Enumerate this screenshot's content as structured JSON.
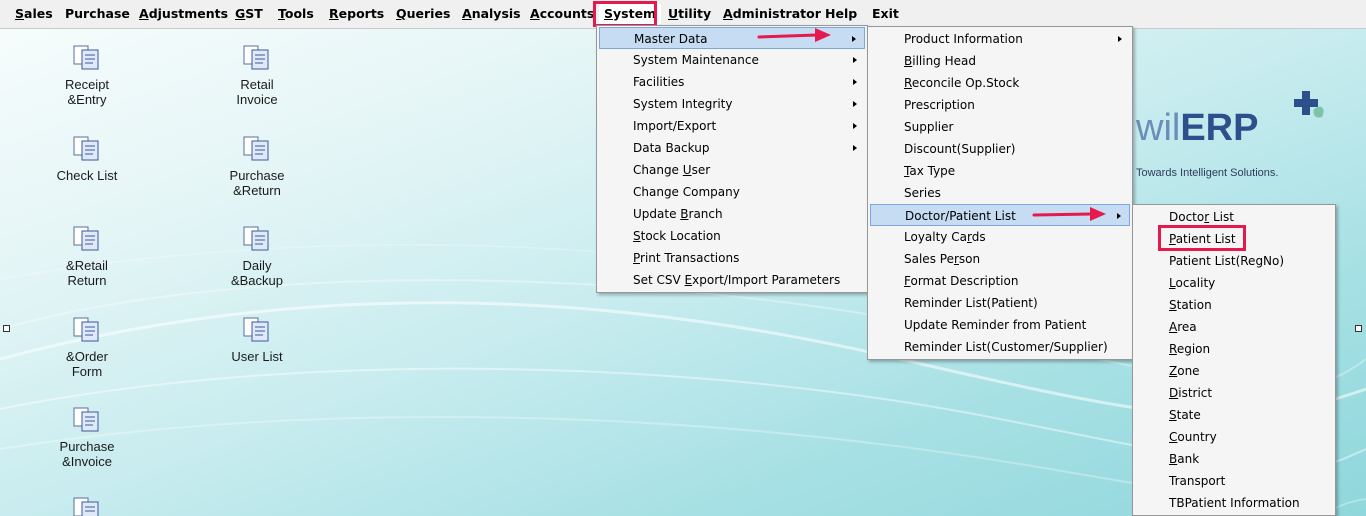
{
  "menubar": {
    "items": [
      {
        "key": "S",
        "rest": "ales"
      },
      {
        "key": "",
        "rest": "Purchase"
      },
      {
        "key": "A",
        "rest": "djustments"
      },
      {
        "key": "G",
        "rest": "ST"
      },
      {
        "key": "T",
        "rest": "ools"
      },
      {
        "key": "R",
        "rest": "eports"
      },
      {
        "key": "Q",
        "rest": "ueries"
      },
      {
        "key": "A",
        "rest": "nalysis"
      },
      {
        "key": "A",
        "rest": "ccounts"
      },
      {
        "key": "S",
        "rest": "ystem"
      },
      {
        "key": "U",
        "rest": "tility"
      },
      {
        "key": "A",
        "rest": "dministrator"
      },
      {
        "key": "",
        "rest": "Help"
      },
      {
        "key": "",
        "rest": "Exit"
      }
    ]
  },
  "desktop_icons": [
    {
      "label": "Receipt\n&Entry"
    },
    {
      "label": "Retail\nInvoice"
    },
    {
      "label": "Check List"
    },
    {
      "label": "Purchase\n&Return"
    },
    {
      "label": "&Retail\nReturn"
    },
    {
      "label": "Daily\n&Backup"
    },
    {
      "label": "&Order\nForm"
    },
    {
      "label": "User List"
    },
    {
      "label": "Purchase\n&Invoice"
    },
    {
      "label": ""
    }
  ],
  "logo": {
    "prefix": "wil",
    "brand": "ERP",
    "tagline": "Towards Intelligent Solutions."
  },
  "system_menu": {
    "items": [
      {
        "pre": "",
        "key": "",
        "post": "Master Data",
        "submenu": true
      },
      {
        "pre": "",
        "key": "",
        "post": "System Maintenance",
        "submenu": true
      },
      {
        "pre": "",
        "key": "",
        "post": "Facilities",
        "submenu": true
      },
      {
        "pre": "",
        "key": "",
        "post": "System Integrity",
        "submenu": true
      },
      {
        "pre": "",
        "key": "",
        "post": "Import/Export",
        "submenu": true
      },
      {
        "pre": "",
        "key": "",
        "post": "Data Backup",
        "submenu": true
      },
      {
        "pre": "Change ",
        "key": "U",
        "post": "ser",
        "submenu": false
      },
      {
        "pre": "Change Company",
        "key": "",
        "post": "",
        "submenu": false
      },
      {
        "pre": "Update ",
        "key": "B",
        "post": "ranch",
        "submenu": false
      },
      {
        "pre": "",
        "key": "S",
        "post": "tock Location",
        "submenu": false
      },
      {
        "pre": "",
        "key": "P",
        "post": "rint Transactions",
        "submenu": false
      },
      {
        "pre": "Set CSV ",
        "key": "E",
        "post": "xport/Import Parameters",
        "submenu": false
      }
    ]
  },
  "master_data_menu": {
    "items": [
      {
        "pre": "Product Information",
        "key": "",
        "post": "",
        "submenu": true
      },
      {
        "pre": "",
        "key": "B",
        "post": "illing Head",
        "submenu": false
      },
      {
        "pre": "",
        "key": "R",
        "post": "econcile Op.Stock",
        "submenu": false
      },
      {
        "pre": "Prescription",
        "key": "",
        "post": "",
        "submenu": false
      },
      {
        "pre": "Supplier",
        "key": "",
        "post": "",
        "submenu": false
      },
      {
        "pre": "Discount(Supplier)",
        "key": "",
        "post": "",
        "submenu": false
      },
      {
        "pre": "",
        "key": "T",
        "post": "ax Type",
        "submenu": false
      },
      {
        "pre": "Series",
        "key": "",
        "post": "",
        "submenu": false
      },
      {
        "pre": "Doctor/Patient List",
        "key": "",
        "post": "",
        "submenu": true
      },
      {
        "pre": "Loyalty Ca",
        "key": "r",
        "post": "ds",
        "submenu": false
      },
      {
        "pre": "Sales Pe",
        "key": "r",
        "post": "son",
        "submenu": false
      },
      {
        "pre": "",
        "key": "F",
        "post": "ormat Description",
        "submenu": false
      },
      {
        "pre": "Reminder List(Patient)",
        "key": "",
        "post": "",
        "submenu": false
      },
      {
        "pre": "Update Reminder from Patient",
        "key": "",
        "post": "",
        "submenu": false
      },
      {
        "pre": "Reminder List(Customer/Supplier)",
        "key": "",
        "post": "",
        "submenu": false
      }
    ]
  },
  "doctor_patient_menu": {
    "items": [
      {
        "pre": "Docto",
        "key": "r",
        "post": " List"
      },
      {
        "pre": "",
        "key": "P",
        "post": "atient List"
      },
      {
        "pre": "Patient List(RegNo)",
        "key": "",
        "post": ""
      },
      {
        "pre": "",
        "key": "L",
        "post": "ocality"
      },
      {
        "pre": "",
        "key": "S",
        "post": "tation"
      },
      {
        "pre": "",
        "key": "A",
        "post": "rea"
      },
      {
        "pre": "",
        "key": "R",
        "post": "egion"
      },
      {
        "pre": "",
        "key": "Z",
        "post": "one"
      },
      {
        "pre": "",
        "key": "D",
        "post": "istrict"
      },
      {
        "pre": "",
        "key": "S",
        "post": "tate"
      },
      {
        "pre": "",
        "key": "C",
        "post": "ountry"
      },
      {
        "pre": "",
        "key": "B",
        "post": "ank"
      },
      {
        "pre": "Transport",
        "key": "",
        "post": ""
      },
      {
        "pre": "TBPatient Information",
        "key": "",
        "post": ""
      }
    ]
  },
  "colors": {
    "highlight_box": "#e6194f",
    "menu_highlight": "#c5dcf3",
    "logo_blue": "#2d4f8c"
  }
}
